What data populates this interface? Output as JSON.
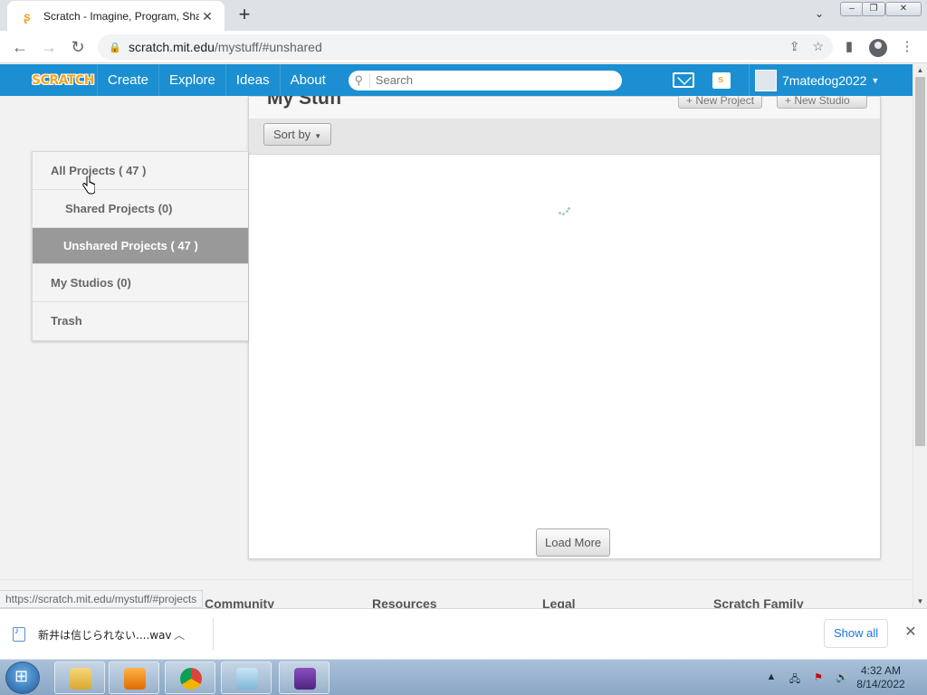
{
  "browser": {
    "tab_title": "Scratch - Imagine, Program, Sha",
    "tab_close": "✕",
    "new_tab": "+",
    "url_domain": "scratch.mit.edu",
    "url_path": "/mystuff/#unshared",
    "status_url": "https://scratch.mit.edu/mystuff/#projects"
  },
  "scratch_nav": {
    "logo": "SCRATCH",
    "links": [
      "Create",
      "Explore",
      "Ideas",
      "About"
    ],
    "search_placeholder": "Search",
    "username": "7matedog2022"
  },
  "page": {
    "title": "My Stuff",
    "new_project": "+ New Project",
    "new_studio": "+ New Studio",
    "sort_by": "Sort by",
    "load_more": "Load More"
  },
  "sidebar": {
    "items": [
      {
        "label": "All Projects ( 47 )"
      },
      {
        "label": "Shared Projects (0)"
      },
      {
        "label": "Unshared Projects ( 47 )"
      },
      {
        "label": "My Studios (0)"
      },
      {
        "label": "Trash"
      }
    ]
  },
  "footer": {
    "headings": [
      "Community",
      "Resources",
      "Legal",
      "Scratch Family"
    ]
  },
  "downloads": {
    "filename": "新井は信じられない....wav",
    "show_all": "Show all"
  },
  "taskbar": {
    "time": "4:32 AM",
    "date": "8/14/2022"
  },
  "colors": {
    "scratch_blue": "#1b8fd1",
    "sidebar_active": "#999999",
    "taskbar": "#9fb8d2"
  }
}
